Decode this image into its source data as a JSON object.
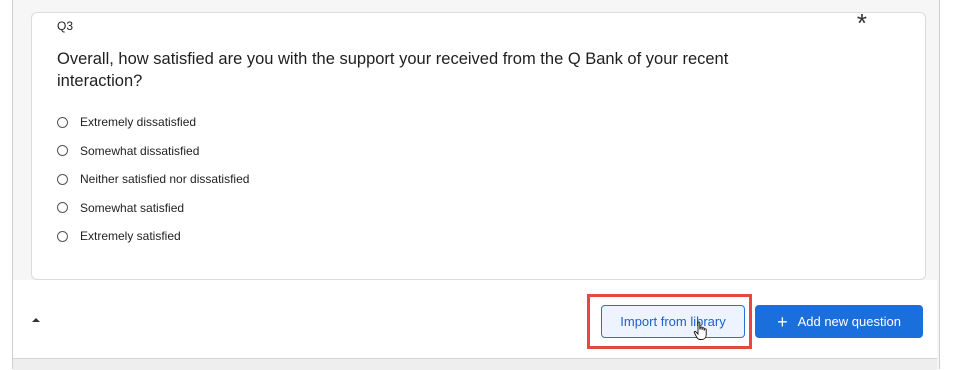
{
  "question": {
    "number": "Q3",
    "text": "Overall, how satisfied are you with the support your received from the Q Bank of your recent interaction?",
    "required_icon": "asterisk-icon",
    "choices": [
      "Extremely dissatisfied",
      "Somewhat dissatisfied",
      "Neither satisfied nor dissatisfied",
      "Somewhat satisfied",
      "Extremely satisfied"
    ]
  },
  "footer": {
    "collapse_icon": "caret-up-icon",
    "import_label": "Import from library",
    "add_label": "Add new question",
    "add_icon": "plus-icon"
  },
  "colors": {
    "primary": "#1a6fdc",
    "highlight": "#e5483f"
  }
}
